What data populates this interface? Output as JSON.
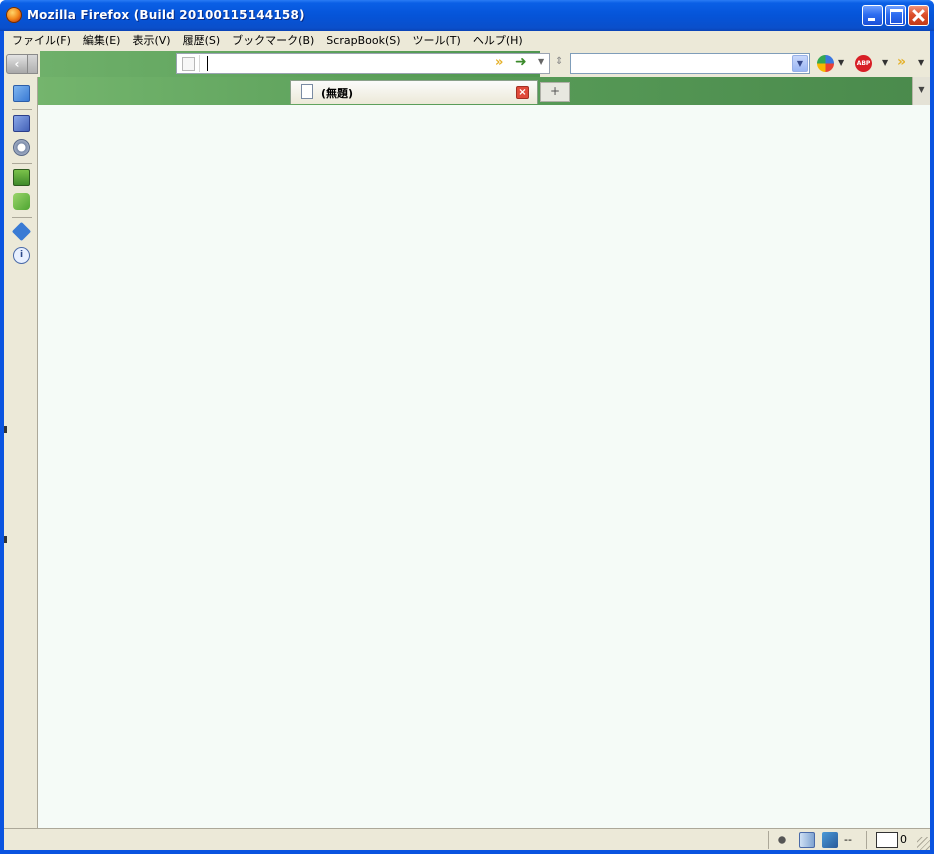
{
  "window": {
    "title": "Mozilla Firefox (Build 20100115144158)"
  },
  "menu": [
    {
      "label": "ファイル(F)"
    },
    {
      "label": "編集(E)"
    },
    {
      "label": "表示(V)"
    },
    {
      "label": "履歴(S)"
    },
    {
      "label": "ブックマーク(B)"
    },
    {
      "label": "ScrapBook(S)"
    },
    {
      "label": "ツール(T)"
    },
    {
      "label": "ヘルプ(H)"
    }
  ],
  "toolbar": {
    "url_value": "",
    "search_value": "",
    "abp_label": "ABP",
    "colors": {
      "accent_green": "#5b9f5a",
      "abp_red": "#d81f26"
    }
  },
  "tabs": [
    {
      "label": "(無題)"
    }
  ],
  "sidebar": {
    "icons": [
      "screenshot-icon",
      "bookmarks-icon",
      "history-icon",
      "downloads-icon",
      "addons-icon",
      "puzzle-icon",
      "info-icon"
    ]
  },
  "status": {
    "text": "",
    "dash_label": "--",
    "mail_count": "0"
  }
}
